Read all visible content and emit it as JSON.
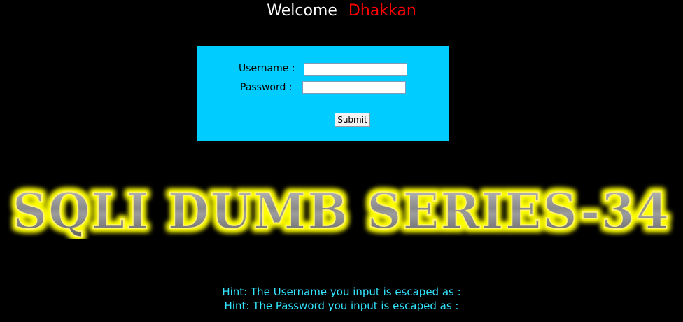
{
  "header": {
    "welcome_label": "Welcome",
    "user_name": "Dhakkan"
  },
  "login_form": {
    "username_label": "Username :",
    "password_label": "Password :",
    "username_value": "",
    "password_value": "",
    "submit_label": "Submit"
  },
  "banner": {
    "title": "SQLI DUMB SERIES-34"
  },
  "hints": {
    "username_hint": "Hint: The Username you input is escaped as :",
    "password_hint": "Hint: The Password you input is escaped as :"
  },
  "colors": {
    "background": "#000000",
    "form_background": "#00ccff",
    "welcome_name": "#ff0000",
    "hint_text": "#33e5ff",
    "banner_glow": "#ffff00"
  }
}
